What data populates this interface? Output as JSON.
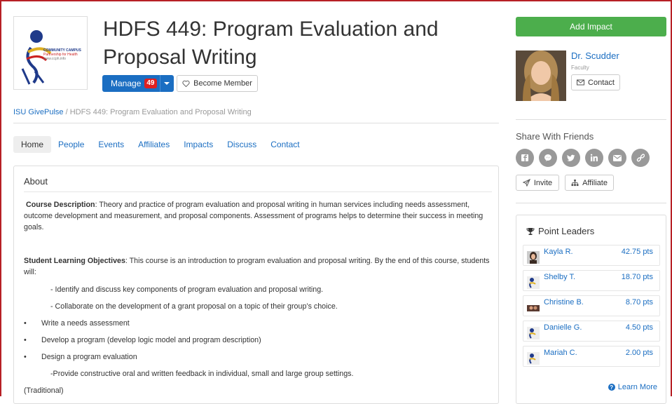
{
  "header": {
    "title": "HDFS 449: Program Evaluation and Proposal Writing",
    "logo": {
      "lines": [
        "COMMUNITY CAMPUS",
        "Partnership for Health",
        "www.ccph.info"
      ]
    },
    "manage_label": "Manage",
    "manage_count": "49",
    "become_member_label": "Become Member"
  },
  "breadcrumb": {
    "root": "ISU GivePulse",
    "separator": " / ",
    "current": "HDFS 449: Program Evaluation and Proposal Writing"
  },
  "tabs": [
    {
      "label": "Home",
      "active": true
    },
    {
      "label": "People"
    },
    {
      "label": "Events"
    },
    {
      "label": "Affiliates"
    },
    {
      "label": "Impacts"
    },
    {
      "label": "Discuss"
    },
    {
      "label": "Contact"
    }
  ],
  "about": {
    "title": "About",
    "course_desc_label": "Course Description",
    "course_desc_text": ":  Theory and practice of program evaluation and proposal writing in human services including needs assessment, outcome development and measurement, and proposal components. Assessment of programs helps to determine their success in meeting goals.",
    "objectives_label": "Student Learning Objectives",
    "objectives_text": ":  This course is an introduction to program evaluation and proposal writing.  By the end of this course, students will:",
    "indent1": "- Identify and discuss key components of program evaluation and proposal writing.",
    "indent2": "- Collaborate on the development of a grant proposal on a topic of their group’s choice.",
    "bullet_char": "•",
    "bullets": [
      "Write a needs assessment",
      "Develop a program (develop logic model and program description)",
      "Design a program evaluation"
    ],
    "indent3": "-Provide constructive oral and written feedback in individual, small and large group settings.",
    "footer": "(Traditional)"
  },
  "sidebar": {
    "add_impact_label": "Add Impact",
    "faculty": {
      "name": "Dr. Scudder",
      "role": "Faculty",
      "contact_label": "Contact"
    },
    "share_title": "Share With Friends",
    "share_icons": [
      "facebook-icon",
      "messenger-icon",
      "twitter-icon",
      "linkedin-icon",
      "email-icon",
      "link-icon"
    ],
    "invite_label": "Invite",
    "affiliate_label": "Affiliate",
    "leaders": {
      "title": "Point Leaders",
      "items": [
        {
          "name": "Kayla R.",
          "points": "42.75 pts"
        },
        {
          "name": "Shelby T.",
          "points": "18.70 pts"
        },
        {
          "name": "Christine B.",
          "points": "8.70 pts"
        },
        {
          "name": "Danielle G.",
          "points": "4.50 pts"
        },
        {
          "name": "Mariah C.",
          "points": "2.00 pts"
        }
      ],
      "learn_more_label": "Learn More"
    }
  },
  "colors": {
    "brand": "#1b6ec2",
    "success": "#4cae4c",
    "badge": "#e02020",
    "frame": "#b72025"
  }
}
